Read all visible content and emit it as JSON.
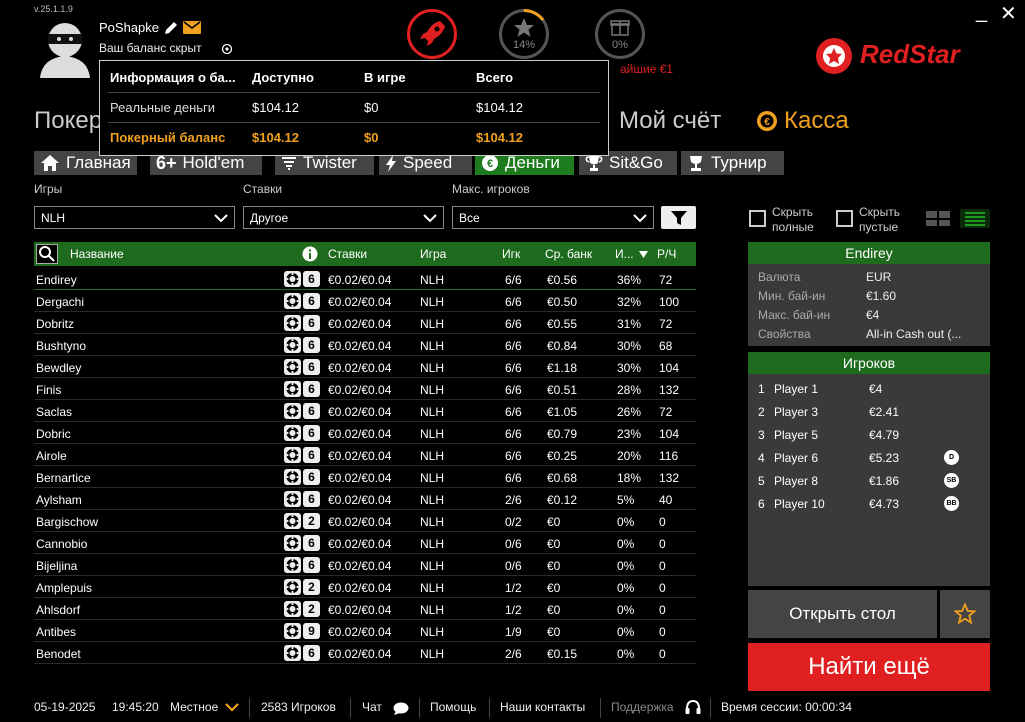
{
  "app": {
    "version": "v.25.1.1.9",
    "brand": "RedStar"
  },
  "window": {
    "minimize": "_",
    "close": "✕"
  },
  "user": {
    "name": "PoShapke",
    "balance_hidden": "Ваш баланс скрыт"
  },
  "status": {
    "progress1": "14%",
    "progress1_value": 0.14,
    "progress2": "0%",
    "promo_fragment": "айшие €1"
  },
  "big_tabs": {
    "poker": "Покер",
    "account": "Мой счёт",
    "cashier": "Касса"
  },
  "balance_popup": {
    "headers": [
      "Информация о ба...",
      "Доступно",
      "В игре",
      "Всего"
    ],
    "rows": [
      {
        "label": "Реальные деньги",
        "available": "$104.12",
        "in_game": "$0",
        "total": "$104.12"
      },
      {
        "label": "Покерный баланс",
        "available": "$104.12",
        "in_game": "$0",
        "total": "$104.12"
      }
    ]
  },
  "nav": [
    {
      "label": "Главная",
      "icon": "home-icon"
    },
    {
      "label": "Hold'em",
      "icon": "six-plus-icon"
    },
    {
      "label": "Twister",
      "icon": "twister-icon"
    },
    {
      "label": "Speed",
      "icon": "lightning-icon"
    },
    {
      "label": "Деньги",
      "icon": "euro-icon"
    },
    {
      "label": "Sit&Go",
      "icon": "trophy-icon"
    },
    {
      "label": "Турнир",
      "icon": "cup-icon"
    }
  ],
  "filters": {
    "games_label": "Игры",
    "games_value": "NLH",
    "stakes_label": "Ставки",
    "stakes_value": "Другое",
    "max_label": "Макс. игроков",
    "max_value": "Все",
    "hide_full": "Скрыть полные",
    "hide_empty": "Скрыть пустые"
  },
  "table_headers": {
    "name": "Название",
    "stakes": "Ставки",
    "game": "Игра",
    "players": "Игк",
    "avg_pot": "Ср. банк",
    "flop": "И...",
    "hands": "Р/Ч"
  },
  "tables": [
    {
      "name": "Endirey",
      "seats": "6",
      "stakes": "€0.02/€0.04",
      "game": "NLH",
      "players": "6/6",
      "pot": "€0.56",
      "pct": "36%",
      "hph": "72"
    },
    {
      "name": "Dergachi",
      "seats": "6",
      "stakes": "€0.02/€0.04",
      "game": "NLH",
      "players": "6/6",
      "pot": "€0.50",
      "pct": "32%",
      "hph": "100"
    },
    {
      "name": "Dobritz",
      "seats": "6",
      "stakes": "€0.02/€0.04",
      "game": "NLH",
      "players": "6/6",
      "pot": "€0.55",
      "pct": "31%",
      "hph": "72"
    },
    {
      "name": "Bushtyno",
      "seats": "6",
      "stakes": "€0.02/€0.04",
      "game": "NLH",
      "players": "6/6",
      "pot": "€0.84",
      "pct": "30%",
      "hph": "68"
    },
    {
      "name": "Bewdley",
      "seats": "6",
      "stakes": "€0.02/€0.04",
      "game": "NLH",
      "players": "6/6",
      "pot": "€1.18",
      "pct": "30%",
      "hph": "104"
    },
    {
      "name": "Finis",
      "seats": "6",
      "stakes": "€0.02/€0.04",
      "game": "NLH",
      "players": "6/6",
      "pot": "€0.51",
      "pct": "28%",
      "hph": "132"
    },
    {
      "name": "Saclas",
      "seats": "6",
      "stakes": "€0.02/€0.04",
      "game": "NLH",
      "players": "6/6",
      "pot": "€1.05",
      "pct": "26%",
      "hph": "72"
    },
    {
      "name": "Dobric",
      "seats": "6",
      "stakes": "€0.02/€0.04",
      "game": "NLH",
      "players": "6/6",
      "pot": "€0.79",
      "pct": "23%",
      "hph": "104"
    },
    {
      "name": "Airole",
      "seats": "6",
      "stakes": "€0.02/€0.04",
      "game": "NLH",
      "players": "6/6",
      "pot": "€0.25",
      "pct": "20%",
      "hph": "116"
    },
    {
      "name": "Bernartice",
      "seats": "6",
      "stakes": "€0.02/€0.04",
      "game": "NLH",
      "players": "6/6",
      "pot": "€0.68",
      "pct": "18%",
      "hph": "132"
    },
    {
      "name": "Aylsham",
      "seats": "6",
      "stakes": "€0.02/€0.04",
      "game": "NLH",
      "players": "2/6",
      "pot": "€0.12",
      "pct": "5%",
      "hph": "40"
    },
    {
      "name": "Bargischow",
      "seats": "2",
      "stakes": "€0.02/€0.04",
      "game": "NLH",
      "players": "0/2",
      "pot": "€0",
      "pct": "0%",
      "hph": "0"
    },
    {
      "name": "Cannobio",
      "seats": "6",
      "stakes": "€0.02/€0.04",
      "game": "NLH",
      "players": "0/6",
      "pot": "€0",
      "pct": "0%",
      "hph": "0"
    },
    {
      "name": "Bijeljina",
      "seats": "6",
      "stakes": "€0.02/€0.04",
      "game": "NLH",
      "players": "0/6",
      "pot": "€0",
      "pct": "0%",
      "hph": "0"
    },
    {
      "name": "Amplepuis",
      "seats": "2",
      "stakes": "€0.02/€0.04",
      "game": "NLH",
      "players": "1/2",
      "pot": "€0",
      "pct": "0%",
      "hph": "0"
    },
    {
      "name": "Ahlsdorf",
      "seats": "2",
      "stakes": "€0.02/€0.04",
      "game": "NLH",
      "players": "1/2",
      "pot": "€0",
      "pct": "0%",
      "hph": "0"
    },
    {
      "name": "Antibes",
      "seats": "9",
      "stakes": "€0.02/€0.04",
      "game": "NLH",
      "players": "1/9",
      "pot": "€0",
      "pct": "0%",
      "hph": "0"
    },
    {
      "name": "Benodet",
      "seats": "6",
      "stakes": "€0.02/€0.04",
      "game": "NLH",
      "players": "2/6",
      "pot": "€0.15",
      "pct": "0%",
      "hph": "0"
    }
  ],
  "detail": {
    "title": "Endirey",
    "props": [
      {
        "k": "Валюта",
        "v": "EUR"
      },
      {
        "k": "Мин. бай-ин",
        "v": "€1.60"
      },
      {
        "k": "Макс. бай-ин",
        "v": "€4"
      },
      {
        "k": "Свойства",
        "v": "All-in Cash out (..."
      }
    ],
    "players_title": "Игроков",
    "players": [
      {
        "n": "1",
        "name": "Player 1",
        "amt": "€4",
        "pos": ""
      },
      {
        "n": "2",
        "name": "Player 3",
        "amt": "€2.41",
        "pos": ""
      },
      {
        "n": "3",
        "name": "Player 5",
        "amt": "€4.79",
        "pos": ""
      },
      {
        "n": "4",
        "name": "Player 6",
        "amt": "€5.23",
        "pos": "D"
      },
      {
        "n": "5",
        "name": "Player 8",
        "amt": "€1.86",
        "pos": "SB"
      },
      {
        "n": "6",
        "name": "Player 10",
        "amt": "€4.73",
        "pos": "BB"
      }
    ],
    "open_button": "Открыть стол",
    "find_button": "Найти ещё"
  },
  "footer": {
    "date": "05-19-2025",
    "time": "19:45:20",
    "tz": "Местное",
    "players": "2583 Игроков",
    "chat": "Чат",
    "help": "Помощь",
    "contacts": "Наши контакты",
    "support": "Поддержка",
    "session": "Время сессии: 00:00:34"
  },
  "colors": {
    "accent_green": "#1e7b1e",
    "brand_red": "#e02020",
    "gold": "#f0a020"
  }
}
